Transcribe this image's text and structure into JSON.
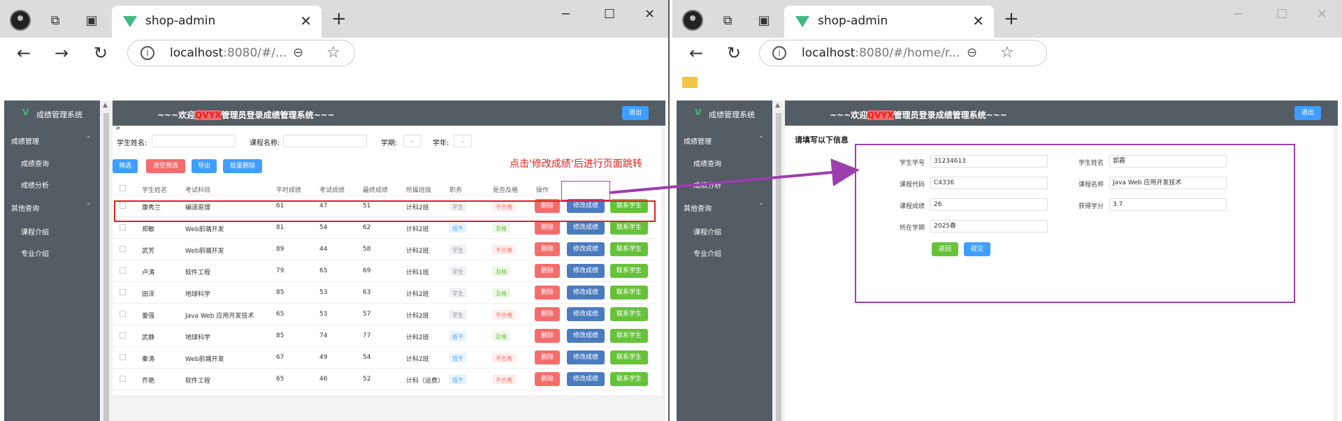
{
  "browser_left": {
    "tab_title": "shop-admin",
    "url": "localhost:8080/#/...",
    "url_host": "localhost",
    "url_rest": ":8080/#/..."
  },
  "browser_right": {
    "tab_title": "shop-admin",
    "url_host": "localhost",
    "url_rest": ":8080/#/home/r..."
  },
  "app": {
    "logo": "V",
    "title": "成绩管理系统",
    "header_prefix": "~~~欢迎",
    "header_user": "QVYX",
    "header_suffix": "管理员登录成绩管理系统~~~",
    "logout_label": "退出",
    "sidebar": {
      "group1": "成绩管理",
      "group1_items": [
        "成绩查询",
        "成绩分析"
      ],
      "group2": "其他查询",
      "group2_items": [
        "课程介绍",
        "专业介绍"
      ]
    }
  },
  "list_page": {
    "breadcrumb": ">",
    "filters": {
      "student_name_label": "学生姓名:",
      "course_name_label": "课程名称:",
      "term_label": "学期:",
      "year_label": "学年:"
    },
    "buttons": {
      "filter": "筛选",
      "clear": "清空筛选",
      "export": "导出",
      "batch_delete": "批量删除"
    },
    "annotation": "点击'修改成绩'后进行页面跳转",
    "columns": [
      "学生姓名",
      "考试科目",
      "平时成绩",
      "考试成绩",
      "最终成绩",
      "所属班级",
      "职务",
      "是否及格",
      "操作"
    ],
    "row_buttons": {
      "delete": "删除",
      "edit": "修改成绩",
      "contact": "联系学生"
    },
    "rows": [
      {
        "name": "康秀兰",
        "course": "编译原理",
        "usual": "61",
        "exam": "47",
        "final": "51",
        "class": "计科2班",
        "role": "学生",
        "role_type": "gray",
        "pass": "不合格",
        "pass_type": "red"
      },
      {
        "name": "郑敏",
        "course": "Web前端开发",
        "usual": "81",
        "exam": "54",
        "final": "62",
        "class": "计科2班",
        "role": "班干",
        "role_type": "blue",
        "pass": "及格",
        "pass_type": "green"
      },
      {
        "name": "武芳",
        "course": "Web前端开发",
        "usual": "89",
        "exam": "44",
        "final": "58",
        "class": "计科2班",
        "role": "学生",
        "role_type": "gray",
        "pass": "不合格",
        "pass_type": "red"
      },
      {
        "name": "卢涛",
        "course": "软件工程",
        "usual": "79",
        "exam": "65",
        "final": "69",
        "class": "计科1班",
        "role": "学生",
        "role_type": "gray",
        "pass": "及格",
        "pass_type": "green"
      },
      {
        "name": "田洋",
        "course": "地球科学",
        "usual": "85",
        "exam": "53",
        "final": "63",
        "class": "计科2班",
        "role": "学生",
        "role_type": "gray",
        "pass": "及格",
        "pass_type": "green"
      },
      {
        "name": "董强",
        "course": "Java Web 应用开发技术",
        "usual": "65",
        "exam": "53",
        "final": "57",
        "class": "计科2班",
        "role": "学生",
        "role_type": "gray",
        "pass": "不合格",
        "pass_type": "red"
      },
      {
        "name": "武静",
        "course": "地球科学",
        "usual": "85",
        "exam": "74",
        "final": "77",
        "class": "计科2班",
        "role": "班干",
        "role_type": "blue",
        "pass": "及格",
        "pass_type": "green"
      },
      {
        "name": "秦涛",
        "course": "Web前端开发",
        "usual": "67",
        "exam": "49",
        "final": "54",
        "class": "计科2班",
        "role": "班干",
        "role_type": "blue",
        "pass": "不合格",
        "pass_type": "red"
      },
      {
        "name": "乔艳",
        "course": "软件工程",
        "usual": "65",
        "exam": "46",
        "final": "52",
        "class": "计科（运费）",
        "role": "班干",
        "role_type": "blue",
        "pass": "不合格",
        "pass_type": "red"
      }
    ]
  },
  "form_page": {
    "title": "请填写以下信息",
    "fields": {
      "student_id_label": "学生学号",
      "student_id": "31234613",
      "student_name_label": "学生姓名",
      "student_name": "郭霞",
      "course_code_label": "课程代码",
      "course_code": "C4336",
      "course_name_label": "课程名称",
      "course_name": "Java Web 应用开发技术",
      "score_label": "课程成绩",
      "score": "26",
      "credit_label": "获得学分",
      "credit": "3.7",
      "term_label": "所在学期",
      "term": "2025春"
    },
    "back_label": "返回",
    "submit_label": "提交"
  },
  "colors": {
    "sidebar": "#545c64",
    "primary": "#409eff",
    "danger": "#f56c6c",
    "success": "#67c23a",
    "annotation": "#e02020",
    "purple": "#9b3fae"
  }
}
